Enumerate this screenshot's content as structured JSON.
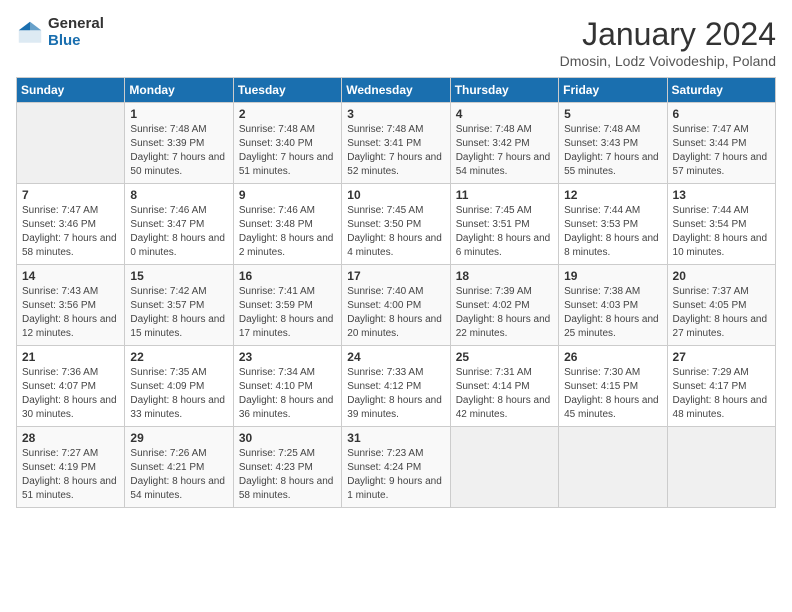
{
  "logo": {
    "general": "General",
    "blue": "Blue"
  },
  "title": "January 2024",
  "subtitle": "Dmosin, Lodz Voivodeship, Poland",
  "days_of_week": [
    "Sunday",
    "Monday",
    "Tuesday",
    "Wednesday",
    "Thursday",
    "Friday",
    "Saturday"
  ],
  "weeks": [
    [
      {
        "day": "",
        "sunrise": "",
        "sunset": "",
        "daylight": ""
      },
      {
        "day": "1",
        "sunrise": "Sunrise: 7:48 AM",
        "sunset": "Sunset: 3:39 PM",
        "daylight": "Daylight: 7 hours and 50 minutes."
      },
      {
        "day": "2",
        "sunrise": "Sunrise: 7:48 AM",
        "sunset": "Sunset: 3:40 PM",
        "daylight": "Daylight: 7 hours and 51 minutes."
      },
      {
        "day": "3",
        "sunrise": "Sunrise: 7:48 AM",
        "sunset": "Sunset: 3:41 PM",
        "daylight": "Daylight: 7 hours and 52 minutes."
      },
      {
        "day": "4",
        "sunrise": "Sunrise: 7:48 AM",
        "sunset": "Sunset: 3:42 PM",
        "daylight": "Daylight: 7 hours and 54 minutes."
      },
      {
        "day": "5",
        "sunrise": "Sunrise: 7:48 AM",
        "sunset": "Sunset: 3:43 PM",
        "daylight": "Daylight: 7 hours and 55 minutes."
      },
      {
        "day": "6",
        "sunrise": "Sunrise: 7:47 AM",
        "sunset": "Sunset: 3:44 PM",
        "daylight": "Daylight: 7 hours and 57 minutes."
      }
    ],
    [
      {
        "day": "7",
        "sunrise": "Sunrise: 7:47 AM",
        "sunset": "Sunset: 3:46 PM",
        "daylight": "Daylight: 7 hours and 58 minutes."
      },
      {
        "day": "8",
        "sunrise": "Sunrise: 7:46 AM",
        "sunset": "Sunset: 3:47 PM",
        "daylight": "Daylight: 8 hours and 0 minutes."
      },
      {
        "day": "9",
        "sunrise": "Sunrise: 7:46 AM",
        "sunset": "Sunset: 3:48 PM",
        "daylight": "Daylight: 8 hours and 2 minutes."
      },
      {
        "day": "10",
        "sunrise": "Sunrise: 7:45 AM",
        "sunset": "Sunset: 3:50 PM",
        "daylight": "Daylight: 8 hours and 4 minutes."
      },
      {
        "day": "11",
        "sunrise": "Sunrise: 7:45 AM",
        "sunset": "Sunset: 3:51 PM",
        "daylight": "Daylight: 8 hours and 6 minutes."
      },
      {
        "day": "12",
        "sunrise": "Sunrise: 7:44 AM",
        "sunset": "Sunset: 3:53 PM",
        "daylight": "Daylight: 8 hours and 8 minutes."
      },
      {
        "day": "13",
        "sunrise": "Sunrise: 7:44 AM",
        "sunset": "Sunset: 3:54 PM",
        "daylight": "Daylight: 8 hours and 10 minutes."
      }
    ],
    [
      {
        "day": "14",
        "sunrise": "Sunrise: 7:43 AM",
        "sunset": "Sunset: 3:56 PM",
        "daylight": "Daylight: 8 hours and 12 minutes."
      },
      {
        "day": "15",
        "sunrise": "Sunrise: 7:42 AM",
        "sunset": "Sunset: 3:57 PM",
        "daylight": "Daylight: 8 hours and 15 minutes."
      },
      {
        "day": "16",
        "sunrise": "Sunrise: 7:41 AM",
        "sunset": "Sunset: 3:59 PM",
        "daylight": "Daylight: 8 hours and 17 minutes."
      },
      {
        "day": "17",
        "sunrise": "Sunrise: 7:40 AM",
        "sunset": "Sunset: 4:00 PM",
        "daylight": "Daylight: 8 hours and 20 minutes."
      },
      {
        "day": "18",
        "sunrise": "Sunrise: 7:39 AM",
        "sunset": "Sunset: 4:02 PM",
        "daylight": "Daylight: 8 hours and 22 minutes."
      },
      {
        "day": "19",
        "sunrise": "Sunrise: 7:38 AM",
        "sunset": "Sunset: 4:03 PM",
        "daylight": "Daylight: 8 hours and 25 minutes."
      },
      {
        "day": "20",
        "sunrise": "Sunrise: 7:37 AM",
        "sunset": "Sunset: 4:05 PM",
        "daylight": "Daylight: 8 hours and 27 minutes."
      }
    ],
    [
      {
        "day": "21",
        "sunrise": "Sunrise: 7:36 AM",
        "sunset": "Sunset: 4:07 PM",
        "daylight": "Daylight: 8 hours and 30 minutes."
      },
      {
        "day": "22",
        "sunrise": "Sunrise: 7:35 AM",
        "sunset": "Sunset: 4:09 PM",
        "daylight": "Daylight: 8 hours and 33 minutes."
      },
      {
        "day": "23",
        "sunrise": "Sunrise: 7:34 AM",
        "sunset": "Sunset: 4:10 PM",
        "daylight": "Daylight: 8 hours and 36 minutes."
      },
      {
        "day": "24",
        "sunrise": "Sunrise: 7:33 AM",
        "sunset": "Sunset: 4:12 PM",
        "daylight": "Daylight: 8 hours and 39 minutes."
      },
      {
        "day": "25",
        "sunrise": "Sunrise: 7:31 AM",
        "sunset": "Sunset: 4:14 PM",
        "daylight": "Daylight: 8 hours and 42 minutes."
      },
      {
        "day": "26",
        "sunrise": "Sunrise: 7:30 AM",
        "sunset": "Sunset: 4:15 PM",
        "daylight": "Daylight: 8 hours and 45 minutes."
      },
      {
        "day": "27",
        "sunrise": "Sunrise: 7:29 AM",
        "sunset": "Sunset: 4:17 PM",
        "daylight": "Daylight: 8 hours and 48 minutes."
      }
    ],
    [
      {
        "day": "28",
        "sunrise": "Sunrise: 7:27 AM",
        "sunset": "Sunset: 4:19 PM",
        "daylight": "Daylight: 8 hours and 51 minutes."
      },
      {
        "day": "29",
        "sunrise": "Sunrise: 7:26 AM",
        "sunset": "Sunset: 4:21 PM",
        "daylight": "Daylight: 8 hours and 54 minutes."
      },
      {
        "day": "30",
        "sunrise": "Sunrise: 7:25 AM",
        "sunset": "Sunset: 4:23 PM",
        "daylight": "Daylight: 8 hours and 58 minutes."
      },
      {
        "day": "31",
        "sunrise": "Sunrise: 7:23 AM",
        "sunset": "Sunset: 4:24 PM",
        "daylight": "Daylight: 9 hours and 1 minute."
      },
      {
        "day": "",
        "sunrise": "",
        "sunset": "",
        "daylight": ""
      },
      {
        "day": "",
        "sunrise": "",
        "sunset": "",
        "daylight": ""
      },
      {
        "day": "",
        "sunrise": "",
        "sunset": "",
        "daylight": ""
      }
    ]
  ]
}
